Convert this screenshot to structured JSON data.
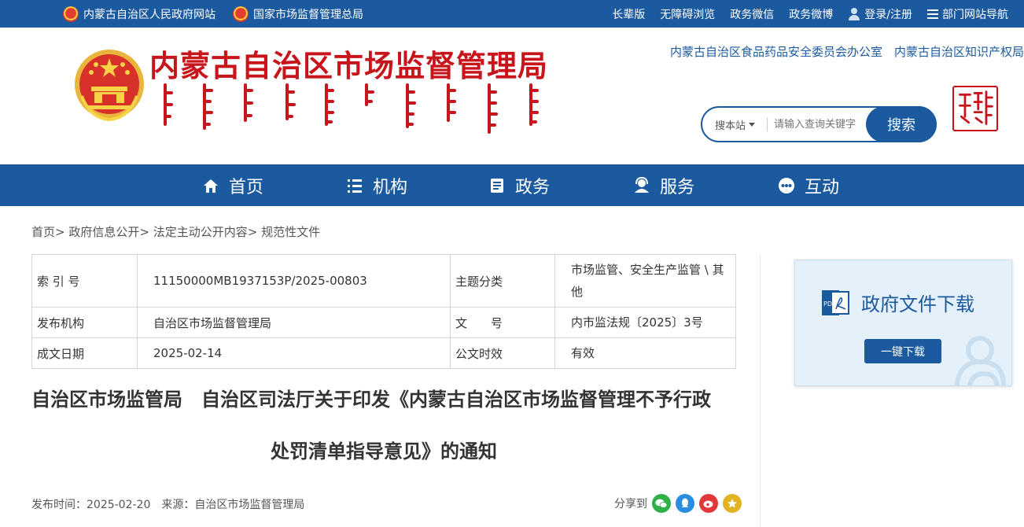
{
  "topbar": {
    "links_left": [
      {
        "label": "内蒙古自治区人民政府网站"
      },
      {
        "label": "国家市场监督管理总局"
      }
    ],
    "links_right": [
      {
        "label": "长辈版"
      },
      {
        "label": "无障碍浏览"
      },
      {
        "label": "政务微信"
      },
      {
        "label": "政务微博"
      },
      {
        "label": "登录/注册"
      },
      {
        "label": "部门网站导航"
      }
    ]
  },
  "header": {
    "site_title": "内蒙古自治区市场监督管理局",
    "links": [
      "内蒙古自治区食品药品安全委员会办公室",
      "内蒙古自治区知识产权局"
    ],
    "search": {
      "scope_label": "搜本站",
      "placeholder": "请输入查询关键字",
      "button_label": "搜索"
    }
  },
  "nav": {
    "items": [
      {
        "label": "首页",
        "icon": "home-icon"
      },
      {
        "label": "机构",
        "icon": "list-icon"
      },
      {
        "label": "政务",
        "icon": "document-icon"
      },
      {
        "label": "服务",
        "icon": "service-icon"
      },
      {
        "label": "互动",
        "icon": "chat-icon"
      }
    ]
  },
  "breadcrumb": {
    "items": [
      "首页",
      "政府信息公开",
      "法定主动公开内容",
      "规范性文件"
    ],
    "separator": ">"
  },
  "info_table": {
    "rows": [
      {
        "label1": "索 引 号",
        "value1": "11150000MB1937153P/2025-00803",
        "label2": "主题分类",
        "value2": "市场监管、安全生产监管 \\ 其他"
      },
      {
        "label1": "发布机构",
        "value1": "自治区市场监督管理局",
        "label2": "文　　号",
        "value2": "内市监法规〔2025〕3号"
      },
      {
        "label1": "成文日期",
        "value1": "2025-02-14",
        "label2": "公文时效",
        "value2": "有效"
      }
    ]
  },
  "article": {
    "title_line1": "自治区市场监管局　自治区司法厅关于印发《内蒙古自治区市场监督管理不予行政",
    "title_line2": "处罚清单指导意见》的通知",
    "meta": "发布时间：2025-02-20　来源：自治区市场监督管理局",
    "share_label": "分享到"
  },
  "sidebar": {
    "download_title": "政府文件下载",
    "download_button": "一键下载"
  },
  "colors": {
    "primary": "#1c5a9f",
    "title_red": "#c8151b"
  }
}
